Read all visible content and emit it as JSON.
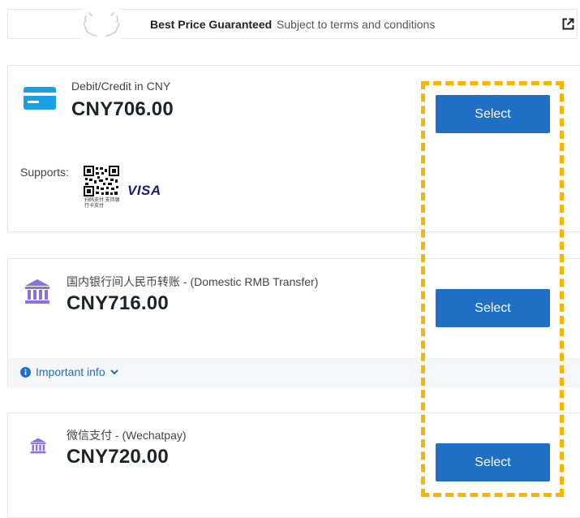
{
  "banner": {
    "title": "Best Price Guaranteed",
    "subtitle": "Subject to terms and conditions",
    "external_icon": "external-link-icon"
  },
  "payment_methods": [
    {
      "name": "Debit/Credit in CNY",
      "price": "CNY706.00",
      "icon": "credit-card-icon",
      "select_label": "Select",
      "supports_label": "Supports:",
      "supports_qr_caption": "扫码支付  支持银行卡支付",
      "supports_brand": "VISA"
    },
    {
      "name": "国内银行间人民币转账 - (Domestic RMB Transfer)",
      "price": "CNY716.00",
      "icon": "bank-icon",
      "select_label": "Select",
      "info_label": "Important info"
    },
    {
      "name": "微信支付 - (Wechatpay)",
      "price": "CNY720.00",
      "icon": "bank-icon",
      "select_label": "Select"
    }
  ],
  "colors": {
    "accent": "#1f6fc5",
    "card_icon": "#1ba1e2",
    "bank_icon": "#8a72d6",
    "highlight": "#f7b500"
  }
}
